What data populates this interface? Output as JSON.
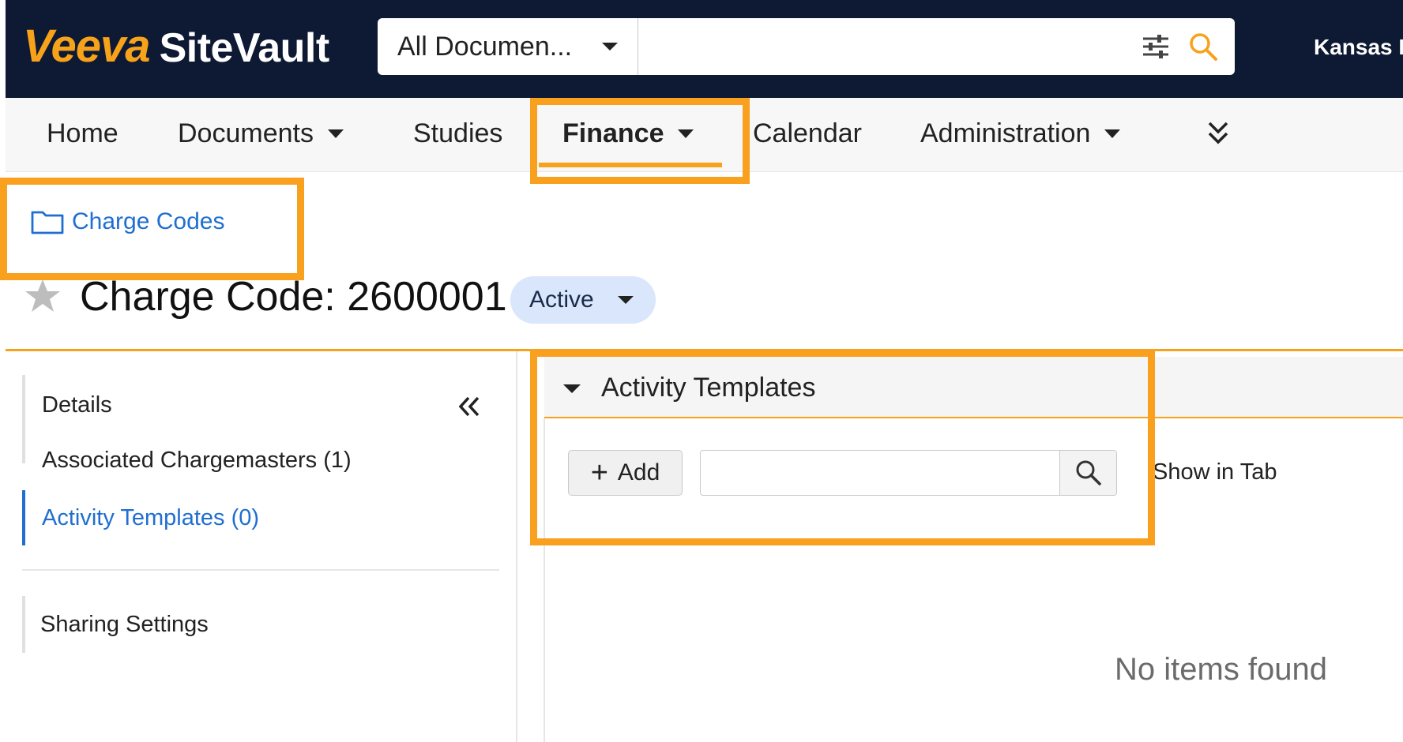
{
  "header": {
    "logo_brand": "Veeva",
    "logo_product": "SiteVault",
    "search_scope": "All Documen...",
    "search_placeholder": "",
    "user_name": "Kansas F"
  },
  "nav": {
    "items": [
      {
        "label": "Home"
      },
      {
        "label": "Documents"
      },
      {
        "label": "Studies"
      },
      {
        "label": "Finance"
      },
      {
        "label": "Calendar"
      },
      {
        "label": "Administration"
      }
    ]
  },
  "breadcrumb": {
    "label": "Charge Codes"
  },
  "record": {
    "title": "Charge Code: 2600001",
    "status": "Active"
  },
  "sidebar": {
    "items": [
      {
        "label": "Details"
      },
      {
        "label": "Associated Chargemasters (1)"
      },
      {
        "label": "Activity Templates (0)"
      },
      {
        "label": "Sharing Settings"
      }
    ]
  },
  "section": {
    "title": "Activity Templates",
    "add_label": "Add",
    "search_placeholder": "",
    "show_in_tab": "Show in Tab",
    "empty_message": "No items found"
  },
  "colors": {
    "header_bg": "#0e1a33",
    "brand_orange": "#f7a21b",
    "highlight": "#f9a01e",
    "link_blue": "#1f6fd1",
    "status_pill": "#d9e6fb"
  }
}
